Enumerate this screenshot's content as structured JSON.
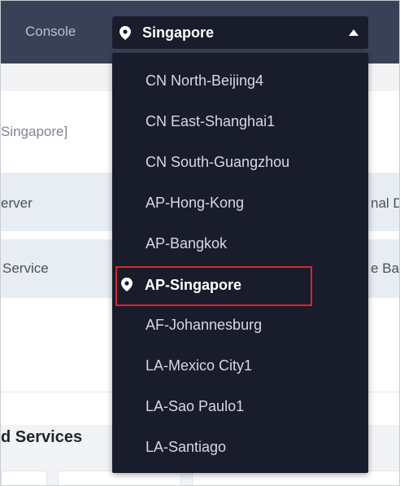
{
  "header": {
    "console_label": "Console",
    "region_selector": {
      "selected": "Singapore",
      "icon": "map-pin-icon",
      "caret": "caret-up-icon"
    }
  },
  "background": {
    "region_text": "Singapore]",
    "row1_left": "erver",
    "row1_right": "nal D",
    "row2_left": "Service",
    "row2_right": "e Bac",
    "section_title": "d Services"
  },
  "dropdown": {
    "options": [
      {
        "label": "CN North-Beijing4"
      },
      {
        "label": "CN East-Shanghai1"
      },
      {
        "label": "CN South-Guangzhou"
      },
      {
        "label": "AP-Hong-Kong"
      },
      {
        "label": "AP-Bangkok"
      },
      {
        "label": "AP-Singapore",
        "selected": true
      },
      {
        "label": "AF-Johannesburg"
      },
      {
        "label": "LA-Mexico City1"
      },
      {
        "label": "LA-Sao Paulo1"
      },
      {
        "label": "LA-Santiago"
      }
    ]
  },
  "colors": {
    "topbar": "#394157",
    "dropdown_bg": "#191c2b",
    "highlight_border": "#d9262c"
  }
}
